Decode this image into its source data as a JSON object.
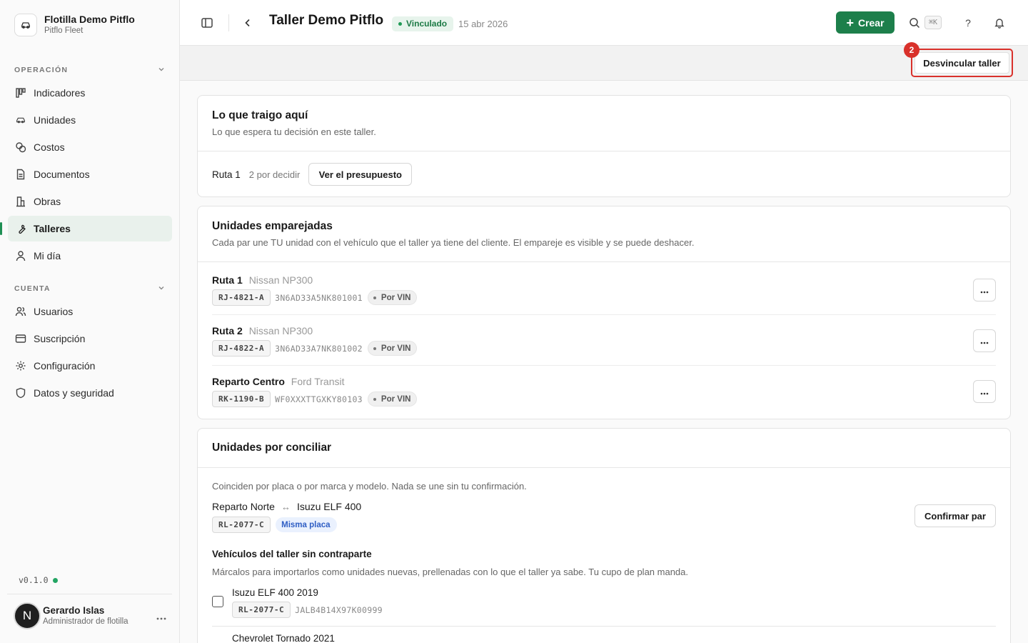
{
  "sidebar": {
    "org_name": "Flotilla Demo Pitflo",
    "org_sub": "Pitflo Fleet",
    "section_operacion": "OPERACIÓN",
    "section_cuenta": "CUENTA",
    "operacion_items": [
      {
        "label": "Indicadores",
        "icon": "kanban-icon"
      },
      {
        "label": "Unidades",
        "icon": "car-icon"
      },
      {
        "label": "Costos",
        "icon": "coins-icon"
      },
      {
        "label": "Documentos",
        "icon": "document-icon"
      },
      {
        "label": "Obras",
        "icon": "building-icon"
      },
      {
        "label": "Talleres",
        "icon": "wrench-icon",
        "active": true
      },
      {
        "label": "Mi día",
        "icon": "person-icon"
      }
    ],
    "cuenta_items": [
      {
        "label": "Usuarios",
        "icon": "users-icon"
      },
      {
        "label": "Suscripción",
        "icon": "credit-card-icon"
      },
      {
        "label": "Configuración",
        "icon": "gear-icon"
      },
      {
        "label": "Datos y seguridad",
        "icon": "shield-icon"
      }
    ],
    "version": "v0.1.0",
    "user": {
      "initial": "N",
      "name": "Gerardo Islas",
      "role": "Administrador de flotilla"
    }
  },
  "header": {
    "title": "Taller Demo Pitflo",
    "status": "Vinculado",
    "date": "15 abr 2026",
    "create_label": "Crear",
    "shortcut": "⌘K",
    "help": "?"
  },
  "toolbar": {
    "unlink_label": "Desvincular taller",
    "badge": "2"
  },
  "colors": {
    "accent": "#1d7f4b",
    "highlight": "#d9312b",
    "status_bg": "#e7f4ec"
  },
  "pending": {
    "title": "Lo que traigo aquí",
    "subtitle": "Lo que espera tu decisión en este taller.",
    "row_name": "Ruta 1",
    "row_count": "2 por decidir",
    "row_button": "Ver el presupuesto"
  },
  "paired": {
    "title": "Unidades emparejadas",
    "subtitle": "Cada par une TU unidad con el vehículo que el taller ya tiene del cliente. El empareje es visible y se puede deshacer.",
    "rows": [
      {
        "name": "Ruta 1",
        "model": "Nissan NP300",
        "plate": "RJ-4821-A",
        "vin": "3N6AD33A5NK801001",
        "match": "Por VIN"
      },
      {
        "name": "Ruta 2",
        "model": "Nissan NP300",
        "plate": "RJ-4822-A",
        "vin": "3N6AD33A7NK801002",
        "match": "Por VIN"
      },
      {
        "name": "Reparto Centro",
        "model": "Ford Transit",
        "plate": "RK-1190-B",
        "vin": "WF0XXXTTGXKY80103",
        "match": "Por VIN"
      }
    ]
  },
  "reconcile": {
    "title": "Unidades por conciliar",
    "intro": "Coinciden por placa o por marca y modelo. Nada se une sin tu confirmación.",
    "candidate": {
      "mine": "Reparto Norte",
      "arrow": "↔",
      "theirs": "Isuzu ELF 400",
      "plate": "RL-2077-C",
      "match": "Misma placa",
      "button": "Confirmar par"
    },
    "orphans_title": "Vehículos del taller sin contraparte",
    "orphans_sub": "Márcalos para importarlos como unidades nuevas, prellenadas con lo que el taller ya sabe. Tu cupo de plan manda.",
    "orphans": [
      {
        "name": "Isuzu ELF 400 2019",
        "plate": "RL-2077-C",
        "vin": "JALB4B14X97K00999"
      },
      {
        "name": "Chevrolet Tornado 2021"
      }
    ]
  }
}
